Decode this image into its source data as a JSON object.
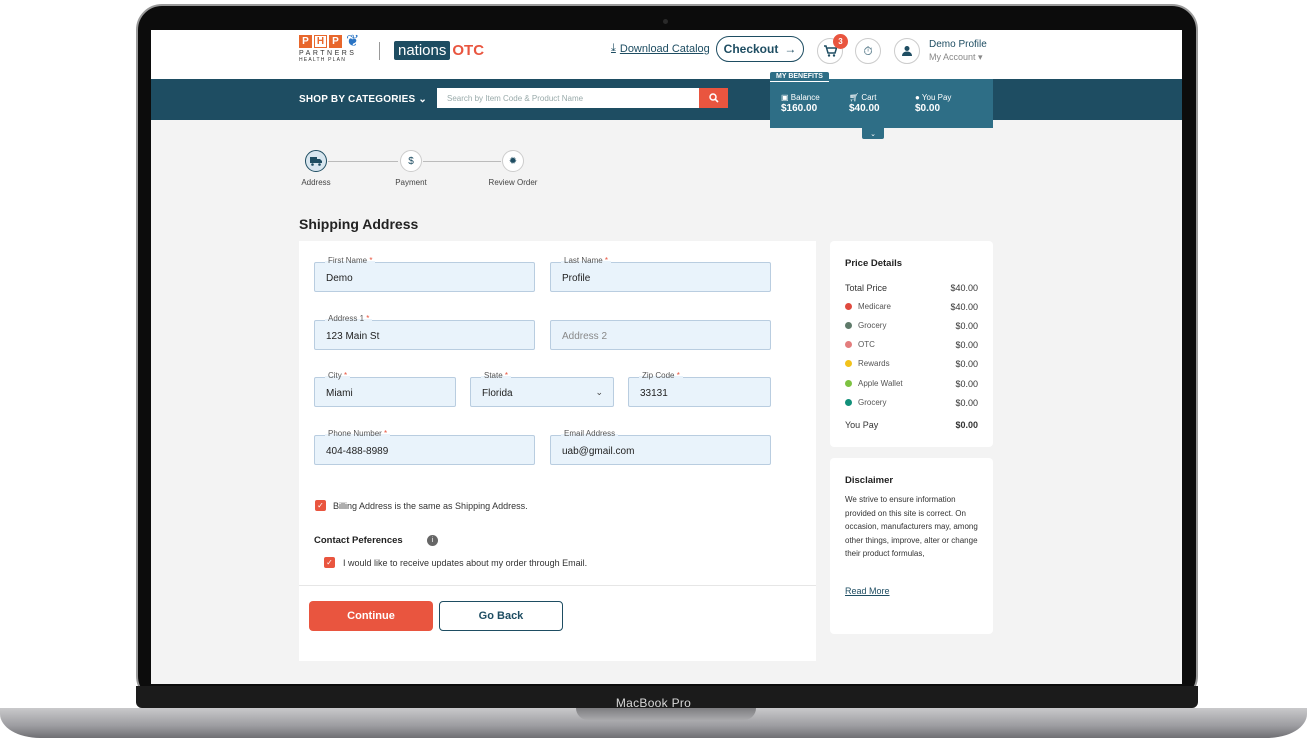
{
  "device_label": "MacBook Pro",
  "header": {
    "logo_php_letters": [
      "P",
      "H",
      "P"
    ],
    "logo_php_line1": "PARTNERS",
    "logo_php_line2": "HEALTH PLAN",
    "logo_nations": "nations",
    "logo_otc": "OTC",
    "download_catalog": "Download Catalog",
    "checkout_label": "Checkout",
    "cart_count": "3",
    "profile_name": "Demo Profile",
    "profile_sub": "My Account"
  },
  "nav": {
    "shop_categories": "SHOP BY CATEGORIES",
    "search_placeholder": "Search by Item Code & Product Name"
  },
  "benefits": {
    "title": "MY BENEFITS",
    "balance_label": "Balance",
    "balance_value": "$160.00",
    "cart_label": "Cart",
    "cart_value": "$40.00",
    "you_pay_label": "You Pay",
    "you_pay_value": "$0.00"
  },
  "stepper": [
    {
      "label": "Address",
      "icon": "truck-icon",
      "active": true
    },
    {
      "label": "Payment",
      "icon": "dollar-icon",
      "active": false
    },
    {
      "label": "Review Order",
      "icon": "gear-icon",
      "active": false
    }
  ],
  "page_title": "Shipping Address",
  "form": {
    "first_name": {
      "label": "First Name",
      "value": "Demo"
    },
    "last_name": {
      "label": "Last Name",
      "value": "Profile"
    },
    "address1": {
      "label": "Address 1",
      "value": "123 Main St"
    },
    "address2": {
      "placeholder": "Address 2"
    },
    "city": {
      "label": "City",
      "value": "Miami"
    },
    "state": {
      "label": "State",
      "value": "Florida"
    },
    "zip": {
      "label": "Zip Code",
      "value": "33131"
    },
    "phone": {
      "label": "Phone Number",
      "value": "404-488-8989"
    },
    "email": {
      "label": "Email Address",
      "value": "uab@gmail.com"
    },
    "billing_same": "Billing Address is the same as Shipping Address.",
    "contact_title": "Contact Peferences",
    "email_updates": "I would like to receive updates about my order through Email.",
    "continue_label": "Continue",
    "go_back_label": "Go Back"
  },
  "price_details": {
    "title": "Price Details",
    "total_price_label": "Total Price",
    "total_price_value": "$40.00",
    "items": [
      {
        "label": "Medicare",
        "value": "$40.00",
        "color": "#e04a3f"
      },
      {
        "label": "Grocery",
        "value": "$0.00",
        "color": "#5f7a6a"
      },
      {
        "label": "OTC",
        "value": "$0.00",
        "color": "#e37d7d"
      },
      {
        "label": "Rewards",
        "value": "$0.00",
        "color": "#f2c21b"
      },
      {
        "label": "Apple Wallet",
        "value": "$0.00",
        "color": "#7dc242"
      },
      {
        "label": "Grocery",
        "value": "$0.00",
        "color": "#12907a"
      }
    ],
    "you_pay_label": "You Pay",
    "you_pay_value": "$0.00"
  },
  "disclaimer": {
    "title": "Disclaimer",
    "text": "We strive to ensure information provided on this site is correct. On occasion, manufacturers may, among other things, improve, alter or change their product formulas,",
    "read_more": "Read More"
  },
  "colors": {
    "brand_dark": "#1e4d62",
    "accent": "#e9553f",
    "benefits_bg": "#2e6e86"
  }
}
